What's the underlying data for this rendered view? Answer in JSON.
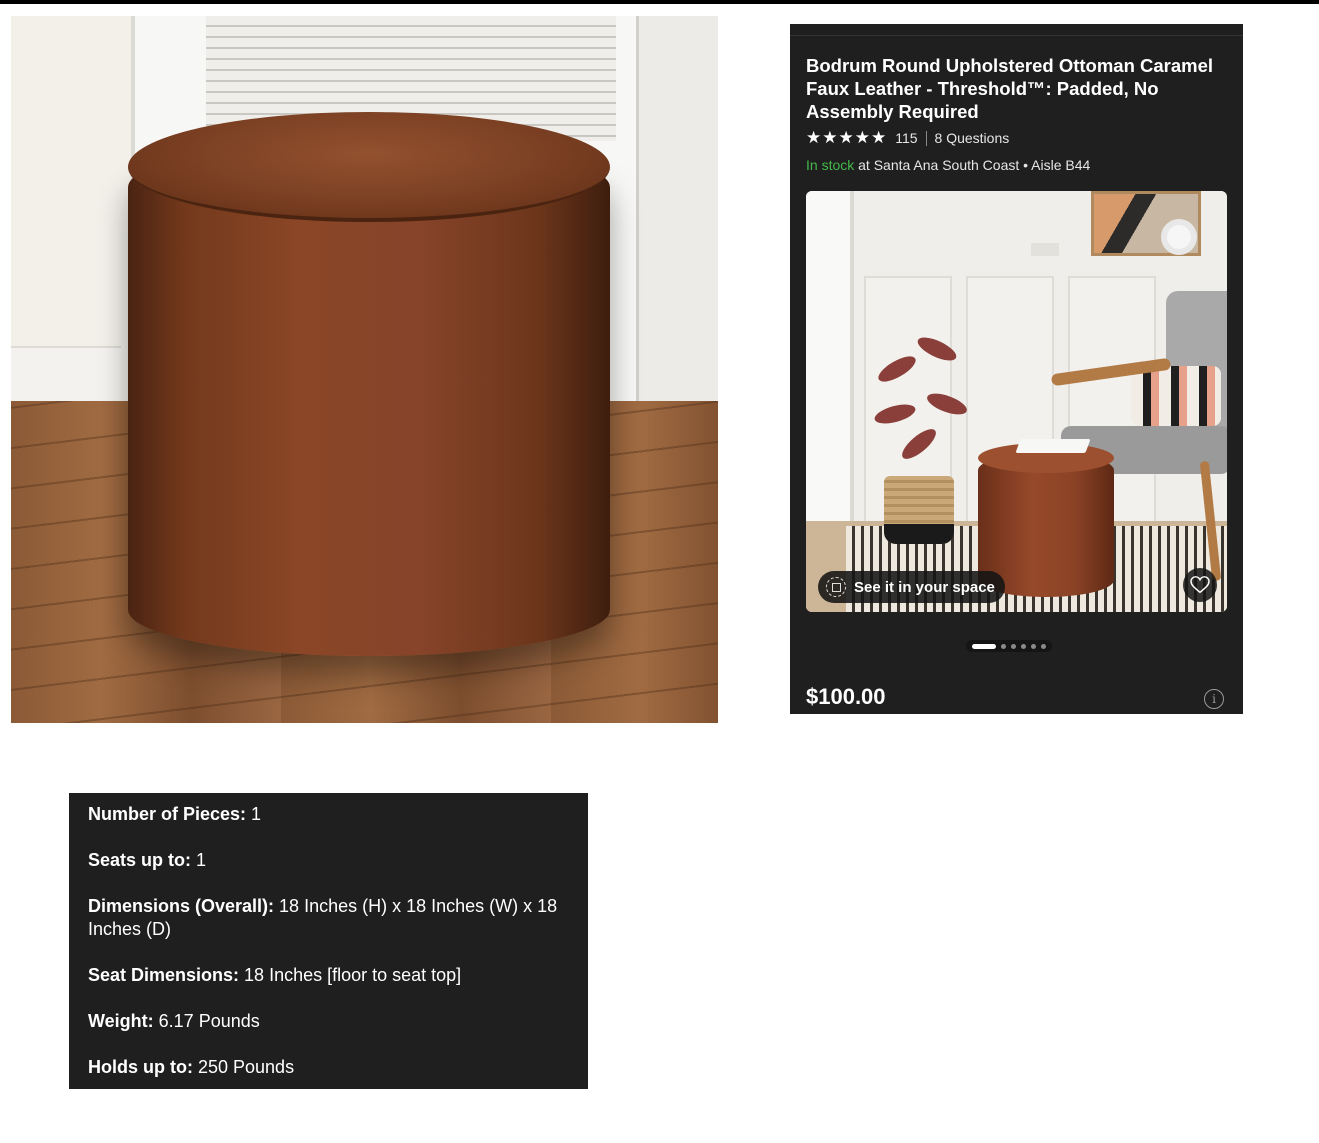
{
  "product": {
    "title": "Bodrum Round Upholstered Ottoman Caramel Faux Leather - Threshold™: Padded, No Assembly Required",
    "stars": "★★★★★",
    "rating_count": "115",
    "questions": "8 Questions",
    "stock_status": "In stock",
    "stock_location": "at Santa Ana South Coast • Aisle B44",
    "see_in_space_label": "See it in your space",
    "price": "$100.00",
    "carousel_total": 6,
    "carousel_active": 1
  },
  "specs": [
    {
      "label": "Number of Pieces:",
      "value": "1"
    },
    {
      "label": "Seats up to:",
      "value": "1"
    },
    {
      "label": "Dimensions (Overall):",
      "value": "18 Inches (H) x 18 Inches (W) x 18 Inches (D)"
    },
    {
      "label": "Seat Dimensions:",
      "value": "18 Inches [floor to seat top]"
    },
    {
      "label": "Weight:",
      "value": "6.17 Pounds"
    },
    {
      "label": "Holds up to:",
      "value": "250 Pounds"
    }
  ],
  "colors": {
    "card_bg": "#1f1f1f",
    "stock_green": "#44b84a",
    "ottoman_brown": "#8a4626"
  },
  "icons": {
    "info": "info-icon",
    "heart": "heart-icon",
    "ar": "ar-cube-icon",
    "star": "star-icon"
  }
}
